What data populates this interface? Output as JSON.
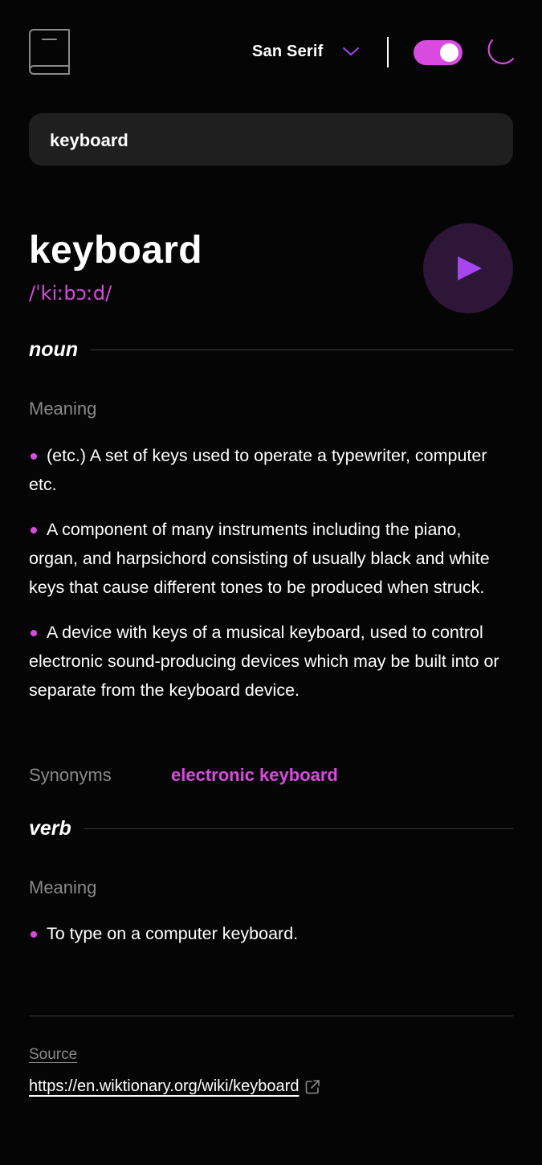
{
  "header": {
    "logo_icon": "book-icon",
    "font_select": {
      "value": "San Serif",
      "icon": "chevron-down-icon"
    },
    "theme_toggle": {
      "state": "on",
      "icon": "moon-icon"
    }
  },
  "search": {
    "value": "keyboard",
    "placeholder": ""
  },
  "word": {
    "title": "keyboard",
    "phonetic": "/ˈkiːbɔːd/",
    "play_icon": "play-icon"
  },
  "meanings": [
    {
      "part_of_speech": "noun",
      "meaning_label": "Meaning",
      "definitions": [
        "(etc.) A set of keys used to operate a typewriter, computer etc.",
        "A component of many instruments including the piano, organ, and harpsichord consisting of usually black and white keys that cause different tones to be produced when struck.",
        "A device with keys of a musical keyboard, used to control electronic sound-producing devices which may be built into or separate from the keyboard device."
      ],
      "synonyms_label": "Synonyms",
      "synonyms": [
        "electronic keyboard"
      ]
    },
    {
      "part_of_speech": "verb",
      "meaning_label": "Meaning",
      "definitions": [
        "To type on a computer keyboard."
      ]
    }
  ],
  "footer": {
    "source_label": "Source",
    "source_url": "https://en.wiktionary.org/wiki/keyboard",
    "external_icon": "external-link-icon"
  },
  "colors": {
    "background": "#050505",
    "accent": "#d94ae0",
    "input_bg": "#1f1f1f",
    "play_bg": "#2d1638",
    "muted": "#8a8a8a"
  }
}
